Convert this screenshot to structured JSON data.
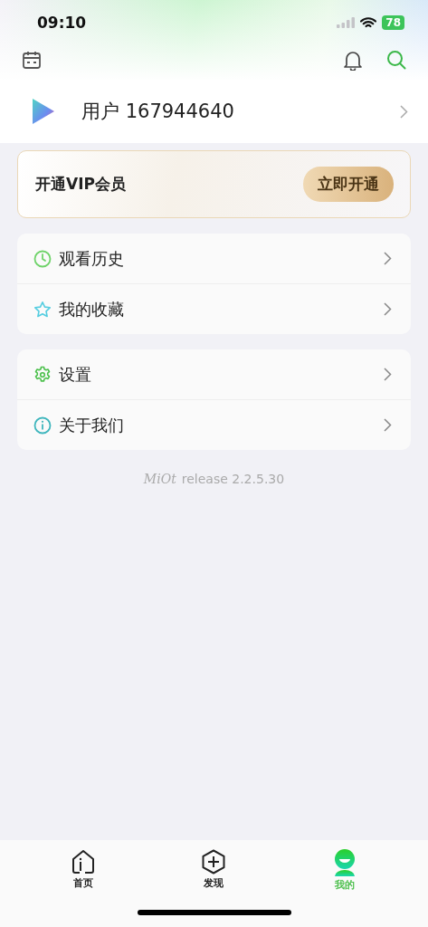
{
  "status_bar": {
    "time": "09:10",
    "battery": "78"
  },
  "user": {
    "name": "用户 167944640"
  },
  "vip": {
    "title": "开通VIP会员",
    "button": "立即开通"
  },
  "menu_groups": [
    {
      "items": [
        {
          "kind": "history",
          "label": "观看历史"
        },
        {
          "kind": "favorites",
          "label": "我的收藏"
        }
      ]
    },
    {
      "items": [
        {
          "kind": "settings",
          "label": "设置"
        },
        {
          "kind": "about",
          "label": "关于我们"
        }
      ]
    }
  ],
  "version": {
    "brand": "MiOt",
    "text": "release 2.2.5.30"
  },
  "tabs": [
    {
      "kind": "home",
      "label": "首页",
      "selected": false
    },
    {
      "kind": "discover",
      "label": "发现",
      "selected": false
    },
    {
      "kind": "mine",
      "label": "我的",
      "selected": true
    }
  ]
}
